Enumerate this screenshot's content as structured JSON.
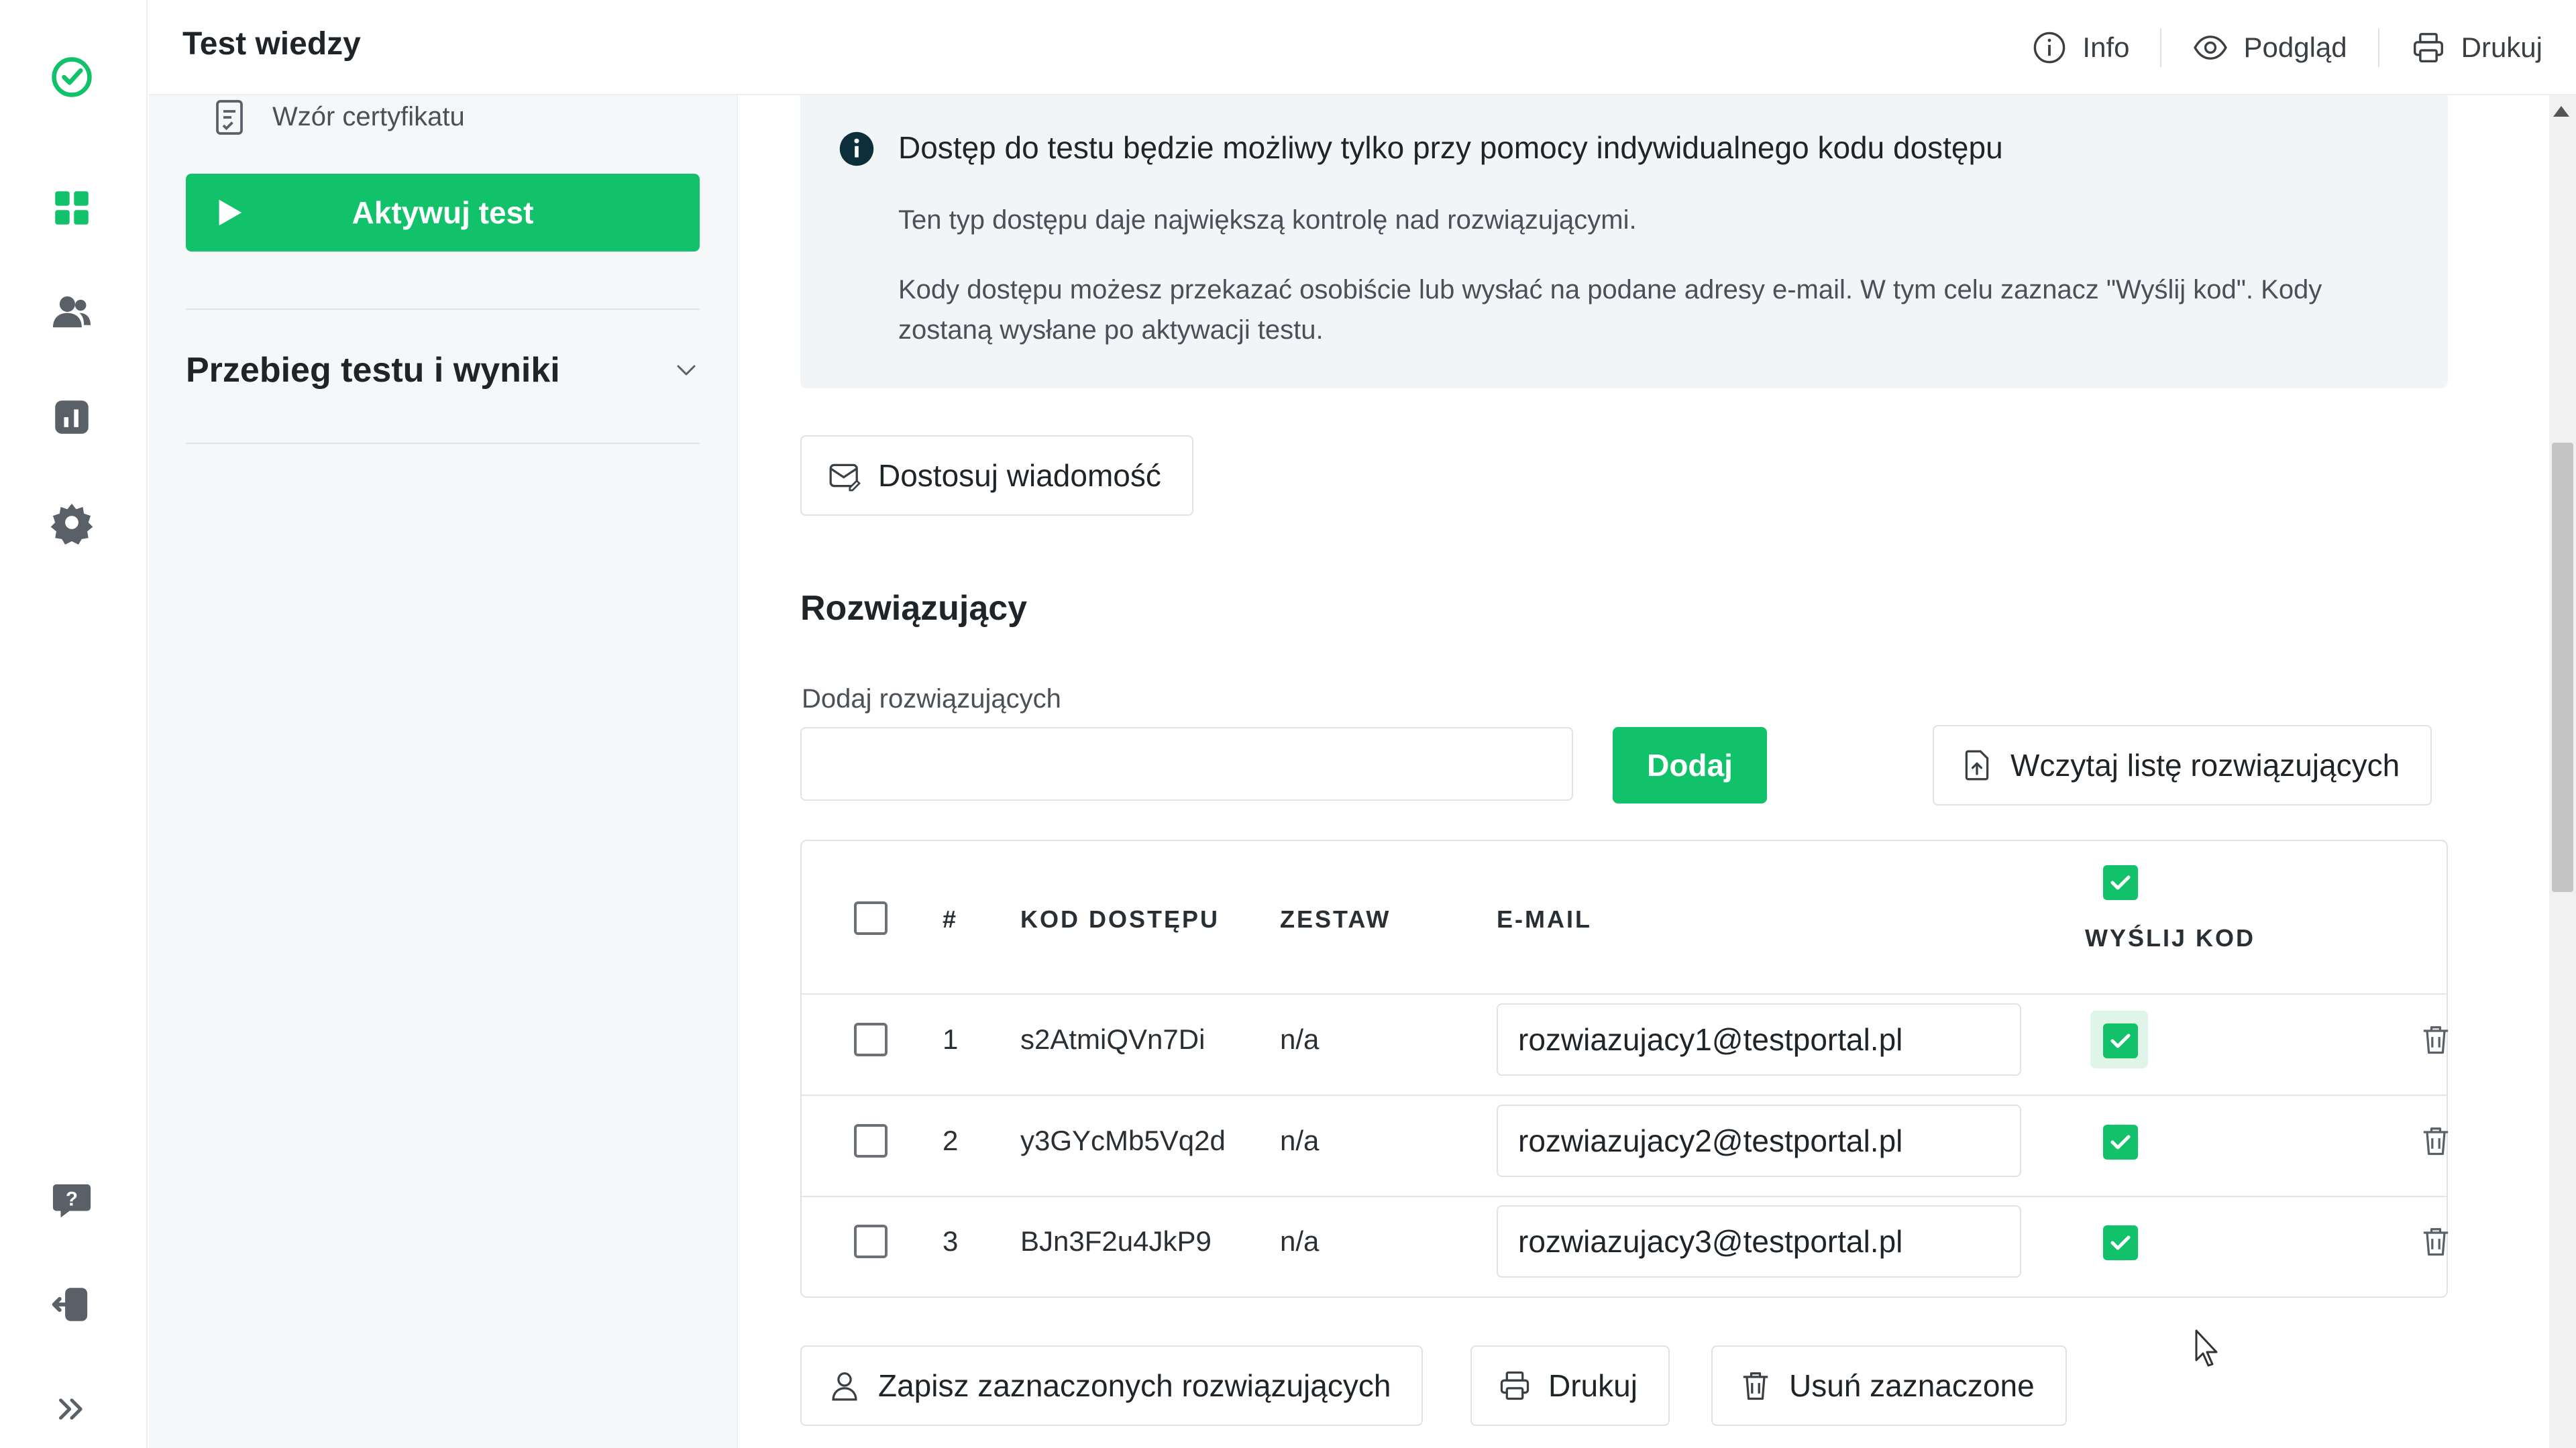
{
  "app": {
    "title": "Test wiedzy"
  },
  "header": {
    "info_label": "Info",
    "preview_label": "Podgląd",
    "print_label": "Drukuj"
  },
  "colors": {
    "accent": "#12c26b",
    "text": "#1f2428",
    "muted": "#4a5056",
    "info_bg": "#f2f5f8"
  },
  "rail": {
    "icons": [
      "logo-check-icon",
      "dashboard-icon",
      "users-icon",
      "results-icon",
      "settings-icon",
      "help-icon",
      "logout-icon",
      "expand-icon"
    ]
  },
  "panel": {
    "certificate_label": "Wzór certyfikatu",
    "activate_label": "Aktywuj test",
    "accordion_title": "Przebieg testu i wyniki"
  },
  "info": {
    "title": "Dostęp do testu będzie możliwy tylko przy pomocy indywidualnego kodu dostępu",
    "paragraph1": "Ten typ dostępu daje największą kontrolę nad rozwiązującymi.",
    "paragraph2": "Kody dostępu możesz przekazać osobiście lub wysłać na podane adresy e-mail. W tym celu zaznacz \"Wyślij kod\". Kody zostaną wysłane po aktywacji testu."
  },
  "customize_label": "Dostosuj wiadomość",
  "section": {
    "title": "Rozwiązujący",
    "add_label": "Dodaj rozwiązujących",
    "add_value": "",
    "add_button": "Dodaj",
    "import_button": "Wczytaj listę rozwiązujących"
  },
  "table": {
    "headers": {
      "num": "#",
      "code": "KOD DOSTĘPU",
      "set": "ZESTAW",
      "email": "E-MAIL",
      "send": "WYŚLIJ KOD"
    },
    "rows": [
      {
        "num": "1",
        "code": "s2AtmiQVn7Di",
        "set": "n/a",
        "email": "rozwiazujacy1@testportal.pl",
        "send": true
      },
      {
        "num": "2",
        "code": "y3GYcMb5Vq2d",
        "set": "n/a",
        "email": "rozwiazujacy2@testportal.pl",
        "send": true
      },
      {
        "num": "3",
        "code": "BJn3F2u4JkP9",
        "set": "n/a",
        "email": "rozwiazujacy3@testportal.pl",
        "send": true
      }
    ]
  },
  "footer": {
    "save_label": "Zapisz zaznaczonych rozwiązujących",
    "print_label": "Drukuj",
    "delete_label": "Usuń zaznaczone"
  }
}
